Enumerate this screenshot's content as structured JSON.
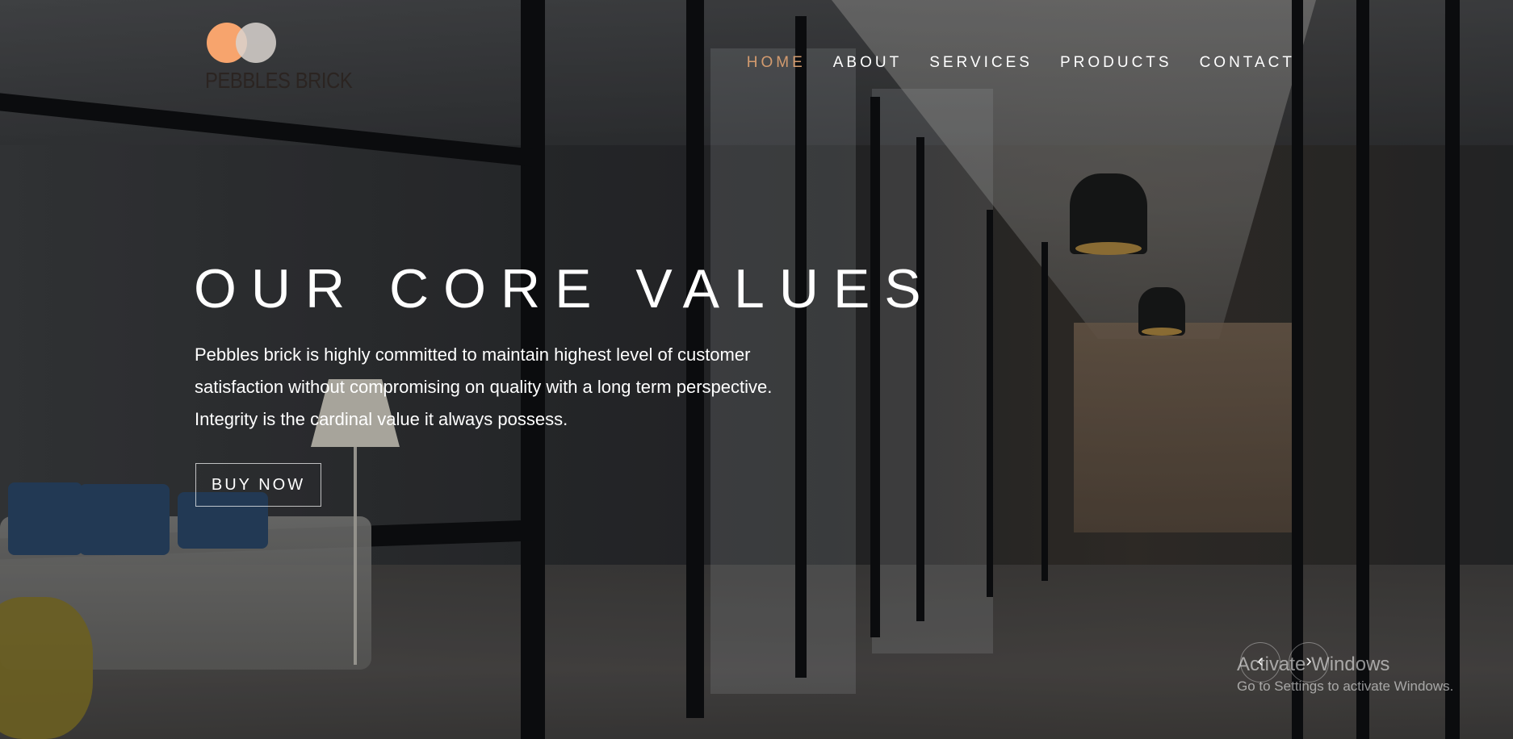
{
  "brand": {
    "name": "PEBBLES BRICK",
    "logo_colors": [
      "#f7a46d",
      "#d9d4cf"
    ]
  },
  "nav": {
    "items": [
      {
        "label": "HOME",
        "active": true
      },
      {
        "label": "ABOUT",
        "active": false
      },
      {
        "label": "SERVICES",
        "active": false
      },
      {
        "label": "PRODUCTS",
        "active": false
      },
      {
        "label": "CONTACT",
        "active": false
      }
    ],
    "active_color": "#d39b6f"
  },
  "hero": {
    "title": "OUR CORE VALUES",
    "text": "Pebbles brick is highly committed to maintain highest level of customer satisfaction without compromising on quality with a long term perspective. Integrity is the cardinal value it always possess.",
    "button_label": "BUY NOW"
  },
  "slider": {
    "prev_icon": "chevron-left-icon",
    "next_icon": "chevron-right-icon",
    "prev_glyph": "‹",
    "next_glyph": "›"
  },
  "watermark": {
    "title": "Activate Windows",
    "subtitle": "Go to Settings to activate Windows."
  }
}
